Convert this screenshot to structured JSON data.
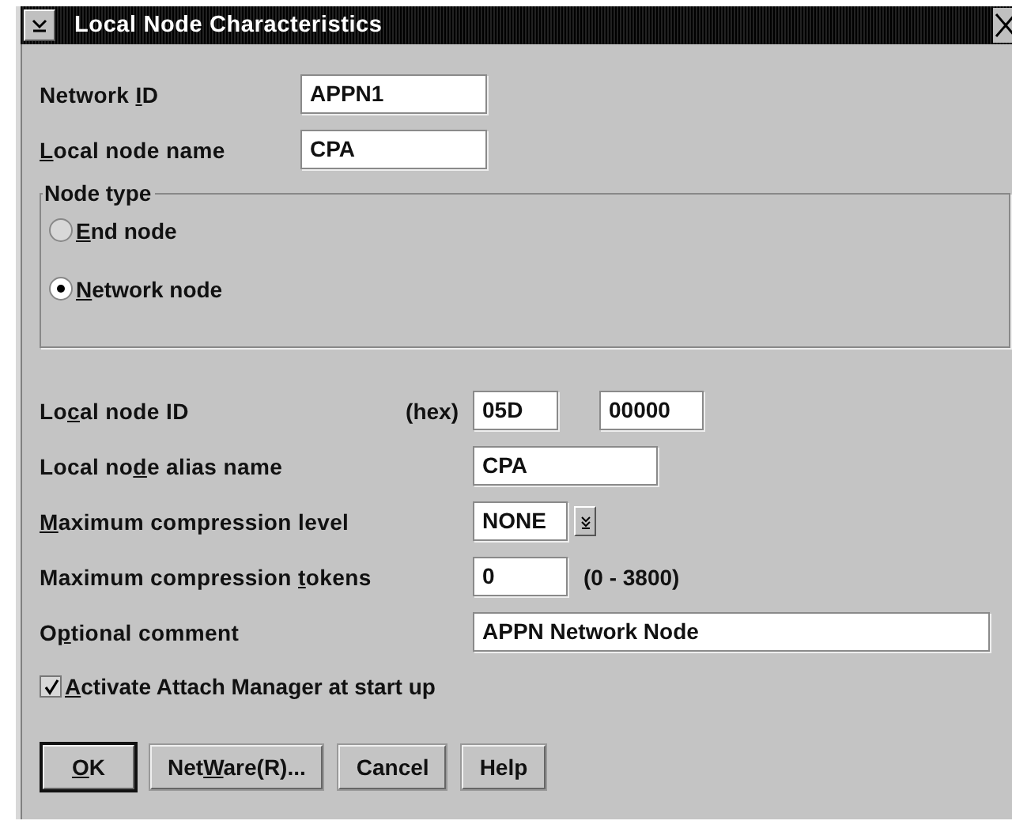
{
  "window": {
    "title": "Local Node Characteristics"
  },
  "top_fields": [
    {
      "label": {
        "pre": "Network ",
        "key": "I",
        "post": "D"
      },
      "value": "APPN1"
    },
    {
      "label": {
        "key": "L",
        "post": "ocal node name"
      },
      "value": "CPA"
    }
  ],
  "node_type": {
    "title": "Node type",
    "options": [
      {
        "label": {
          "key": "E",
          "post": "nd node"
        },
        "selected": false
      },
      {
        "label": {
          "key": "N",
          "post": "etwork node"
        },
        "selected": true
      }
    ]
  },
  "fields": [
    {
      "kind": "pair",
      "label": {
        "pre": "Lo",
        "key": "c",
        "post": "al node ID"
      },
      "unit": "(hex)",
      "values": [
        "05D",
        "00000"
      ]
    },
    {
      "kind": "short",
      "label": {
        "pre": "Local no",
        "key": "d",
        "post": "e alias name"
      },
      "value": "CPA"
    },
    {
      "kind": "dropdown",
      "label": {
        "key": "M",
        "post": "aximum compression level"
      },
      "value": "NONE"
    },
    {
      "kind": "range",
      "label": {
        "pre": "Maximum compression ",
        "key": "t",
        "post": "okens"
      },
      "value": "0",
      "range": "(0 - 3800)"
    },
    {
      "kind": "wide",
      "label": {
        "pre": "O",
        "key": "p",
        "post": "tional comment"
      },
      "value": "APPN Network Node"
    }
  ],
  "checkbox": {
    "label": {
      "key": "A",
      "post": "ctivate Attach Manager at start up"
    },
    "checked": true
  },
  "buttons": [
    {
      "label": {
        "key": "O",
        "post": "K"
      },
      "default": true
    },
    {
      "label": {
        "pre": "Net",
        "key": "W",
        "post": "are(R)..."
      },
      "default": false
    },
    {
      "label": {
        "pre": "Cancel"
      },
      "default": false
    },
    {
      "label": {
        "pre": "Help"
      },
      "default": false
    }
  ]
}
